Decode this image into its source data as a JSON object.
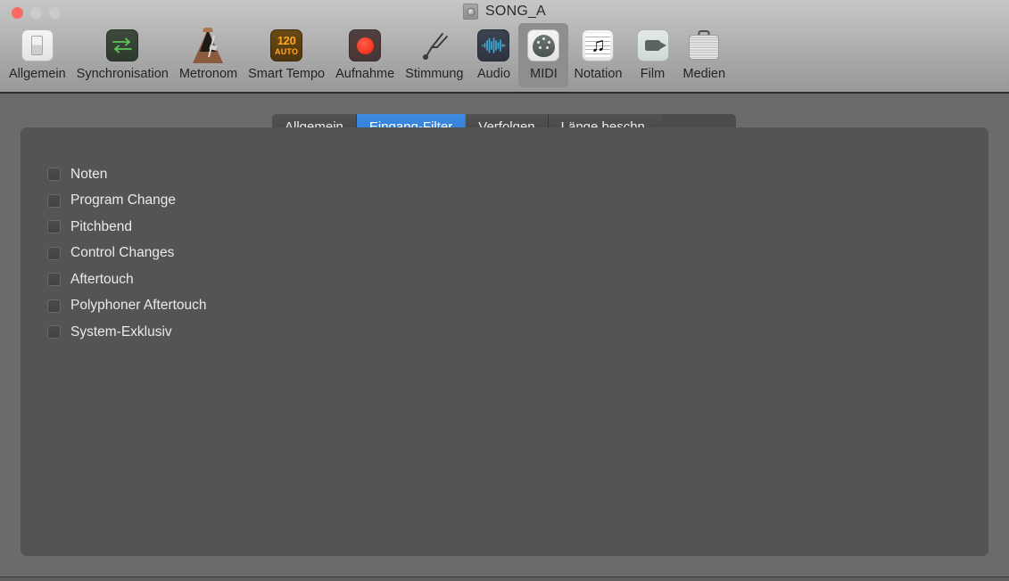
{
  "window": {
    "title": "SONG_A",
    "title_icon": "logic-project-icon",
    "traffic_lights": [
      {
        "name": "close-button",
        "color": "#fd6b60"
      },
      {
        "name": "minimize-button",
        "color": "#cccccc"
      },
      {
        "name": "zoom-button",
        "color": "#cbcbcb"
      }
    ]
  },
  "toolbar": {
    "items": [
      {
        "label": "Allgemein",
        "icon": "light-switch-icon",
        "selected": false
      },
      {
        "label": "Synchronisation",
        "icon": "sync-arrows-icon",
        "selected": false
      },
      {
        "label": "Metronom",
        "icon": "metronome-icon",
        "selected": false
      },
      {
        "label": "Smart Tempo",
        "icon": "tempo-badge-icon",
        "selected": false,
        "badge_number": "120",
        "badge_mode": "AUTO"
      },
      {
        "label": "Aufnahme",
        "icon": "record-dot-icon",
        "selected": false
      },
      {
        "label": "Stimmung",
        "icon": "tuning-fork-icon",
        "selected": false
      },
      {
        "label": "Audio",
        "icon": "waveform-icon",
        "selected": false
      },
      {
        "label": "MIDI",
        "icon": "midi-din-connector-icon",
        "selected": true
      },
      {
        "label": "Notation",
        "icon": "music-staff-note-icon",
        "selected": false
      },
      {
        "label": "Film",
        "icon": "video-camera-icon",
        "selected": false
      },
      {
        "label": "Medien",
        "icon": "briefcase-icon",
        "selected": false
      }
    ]
  },
  "tabs": {
    "active_index": 1,
    "items": [
      {
        "label": "Allgemein"
      },
      {
        "label": "Eingang-Filter"
      },
      {
        "label": "Verfolgen"
      },
      {
        "label": "Länge beschn."
      }
    ],
    "active_color": "#337dd4"
  },
  "panel": {
    "checkboxes": [
      {
        "label": "Noten",
        "checked": false
      },
      {
        "label": "Program Change",
        "checked": false
      },
      {
        "label": "Pitchbend",
        "checked": false
      },
      {
        "label": "Control Changes",
        "checked": false
      },
      {
        "label": "Aftertouch",
        "checked": false
      },
      {
        "label": "Polyphoner Aftertouch",
        "checked": false
      },
      {
        "label": "System-Exklusiv",
        "checked": false
      }
    ]
  },
  "colors": {
    "window_bg": "#6b6b6b",
    "panel_bg": "#545454",
    "toolbar_top": "#c6c6c6",
    "toolbar_bottom": "#989898",
    "tab_inactive": "#4b4b4b",
    "tab_active": "#337dd4",
    "text_light": "#eaeaea",
    "text_dark": "#242424"
  }
}
